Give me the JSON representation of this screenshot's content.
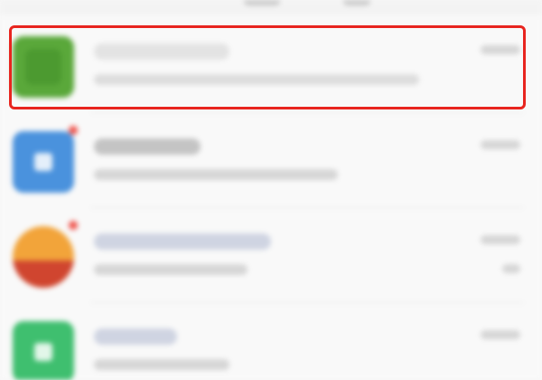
{
  "screen": {
    "rows": [
      {
        "app": "green",
        "has_badge": false,
        "highlighted": true
      },
      {
        "app": "blue",
        "has_badge": true,
        "highlighted": false
      },
      {
        "app": "orange",
        "has_badge": true,
        "highlighted": false
      },
      {
        "app": "teal",
        "has_badge": false,
        "highlighted": false
      }
    ]
  },
  "icons": {
    "row1": "app-icon-green",
    "row2": "app-icon-blue",
    "row3": "app-icon-orange",
    "row4": "app-icon-teal"
  },
  "colors": {
    "highlight_border": "#e8251f",
    "badge": "#f0524a",
    "app_green": "#5aa83a",
    "app_blue": "#4a92dd",
    "app_orange": "#f2a43a",
    "app_teal": "#3fbf6f"
  }
}
